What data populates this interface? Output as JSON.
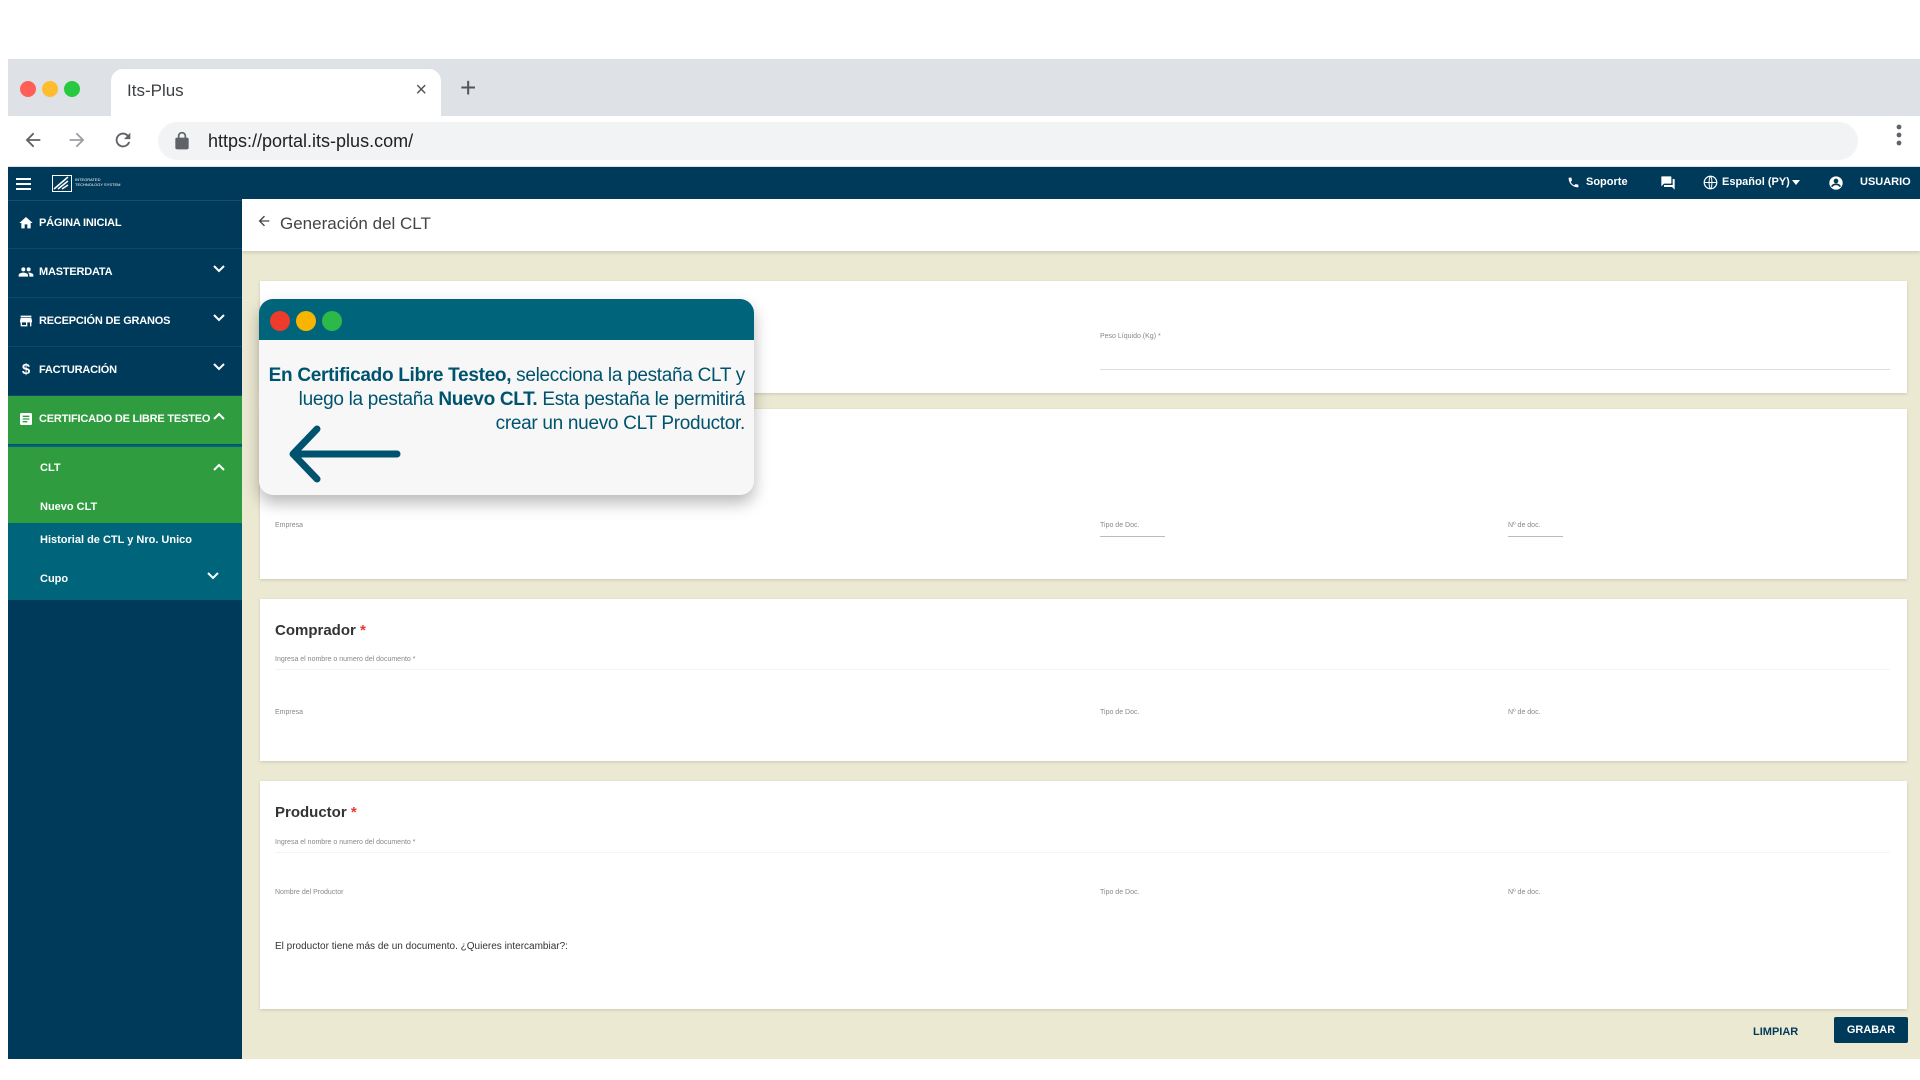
{
  "browser": {
    "tab_title": "Its-Plus",
    "url": "https://portal.its-plus.com/",
    "close_glyph": "×",
    "new_tab_glyph": "+",
    "traffic_colors": [
      "#ff5f57",
      "#febc2e",
      "#28c840"
    ]
  },
  "sidebar": {
    "logo_text_1": "INTEGRATED",
    "logo_text_2": "TECHNOLOGY SYSTEM",
    "items": [
      {
        "label": "PÁGINA INICIAL",
        "icon": "home-icon"
      },
      {
        "label": "MASTERDATA",
        "icon": "people-icon"
      },
      {
        "label": "RECEPCIÓN DE GRANOS",
        "icon": "store-icon"
      },
      {
        "label": "FACTURACIÓN",
        "icon": "dollar-icon"
      },
      {
        "label": "CERTIFICADO DE LIBRE TESTEO",
        "icon": "document-icon"
      }
    ],
    "clt_label": "CLT",
    "sub_items": [
      "Nuevo CLT",
      "Historial de CTL y Nro. Unico",
      "Cupo"
    ]
  },
  "topbar": {
    "support": "Soporte",
    "language": "Español (PY)",
    "user": "USUARIO"
  },
  "page": {
    "title": "Generación del CLT"
  },
  "cards": {
    "card1": {
      "peso_label": "Peso Líquido (Kg) *"
    },
    "card2": {
      "empresa": "Empresa",
      "tipo_doc": "Tipo de Doc.",
      "nro_doc": "Nº de doc."
    },
    "comprador": {
      "title": "Comprador",
      "search_label": "Ingresa el nombre o numero del documento *",
      "empresa": "Empresa",
      "tipo_doc": "Tipo de Doc.",
      "nro_doc": "Nº de doc."
    },
    "productor": {
      "title": "Productor",
      "search_label": "Ingresa el nombre o numero del documento *",
      "nombre": "Nombre del Productor",
      "tipo_doc": "Tipo de Doc.",
      "nro_doc": "Nº de doc.",
      "question": "El productor tiene más de un documento. ¿Quieres intercambiar?:"
    },
    "required_mark": "*"
  },
  "actions": {
    "limpiar": "LIMPIAR",
    "grabar": "GRABAR"
  },
  "popup": {
    "bold1": "En Certificado Libre Testeo,",
    "text1": " selecciona la pestaña CLT y luego la pestaña ",
    "bold2": "Nuevo CLT.",
    "text2": " Esta pestaña le permitirá crear un nuevo CLT Productor.",
    "accent_color": "#00647a",
    "dot_colors": [
      "#ee3b2b",
      "#f7b500",
      "#2db84a"
    ]
  },
  "colors": {
    "sidebar_bg": "#003a5a",
    "active_green": "#2e9c3f",
    "content_bg": "#ece9d3"
  }
}
